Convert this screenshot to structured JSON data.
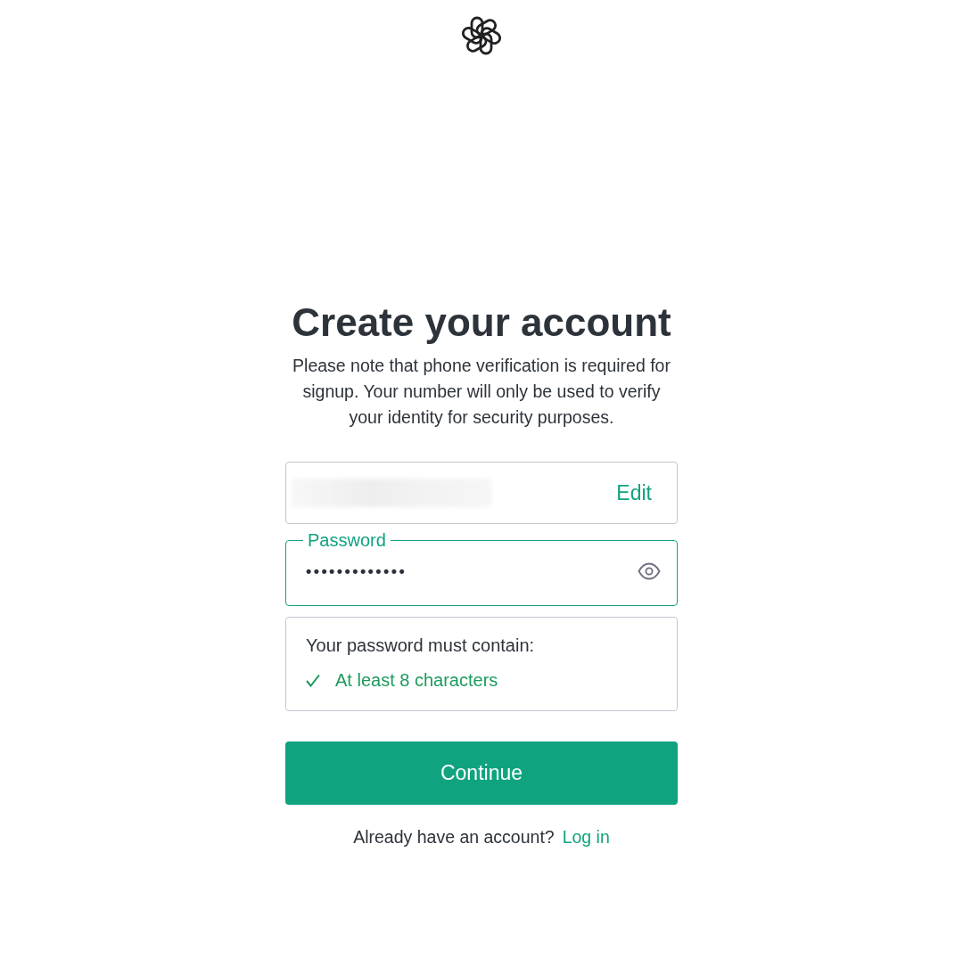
{
  "heading": "Create your account",
  "notice": "Please note that phone verification is required for signup. Your number will only be used to verify your identity for security purposes.",
  "email_field": {
    "value_redacted": true,
    "action": "Edit"
  },
  "password_field": {
    "label": "Password",
    "value": "•••••••••••••",
    "focused": true
  },
  "requirements": {
    "title": "Your password must contain:",
    "rules": [
      {
        "text": "At least 8 characters",
        "met": true
      }
    ]
  },
  "continue_button": "Continue",
  "login_prompt": {
    "text": "Already have an account?",
    "link": "Log in"
  }
}
